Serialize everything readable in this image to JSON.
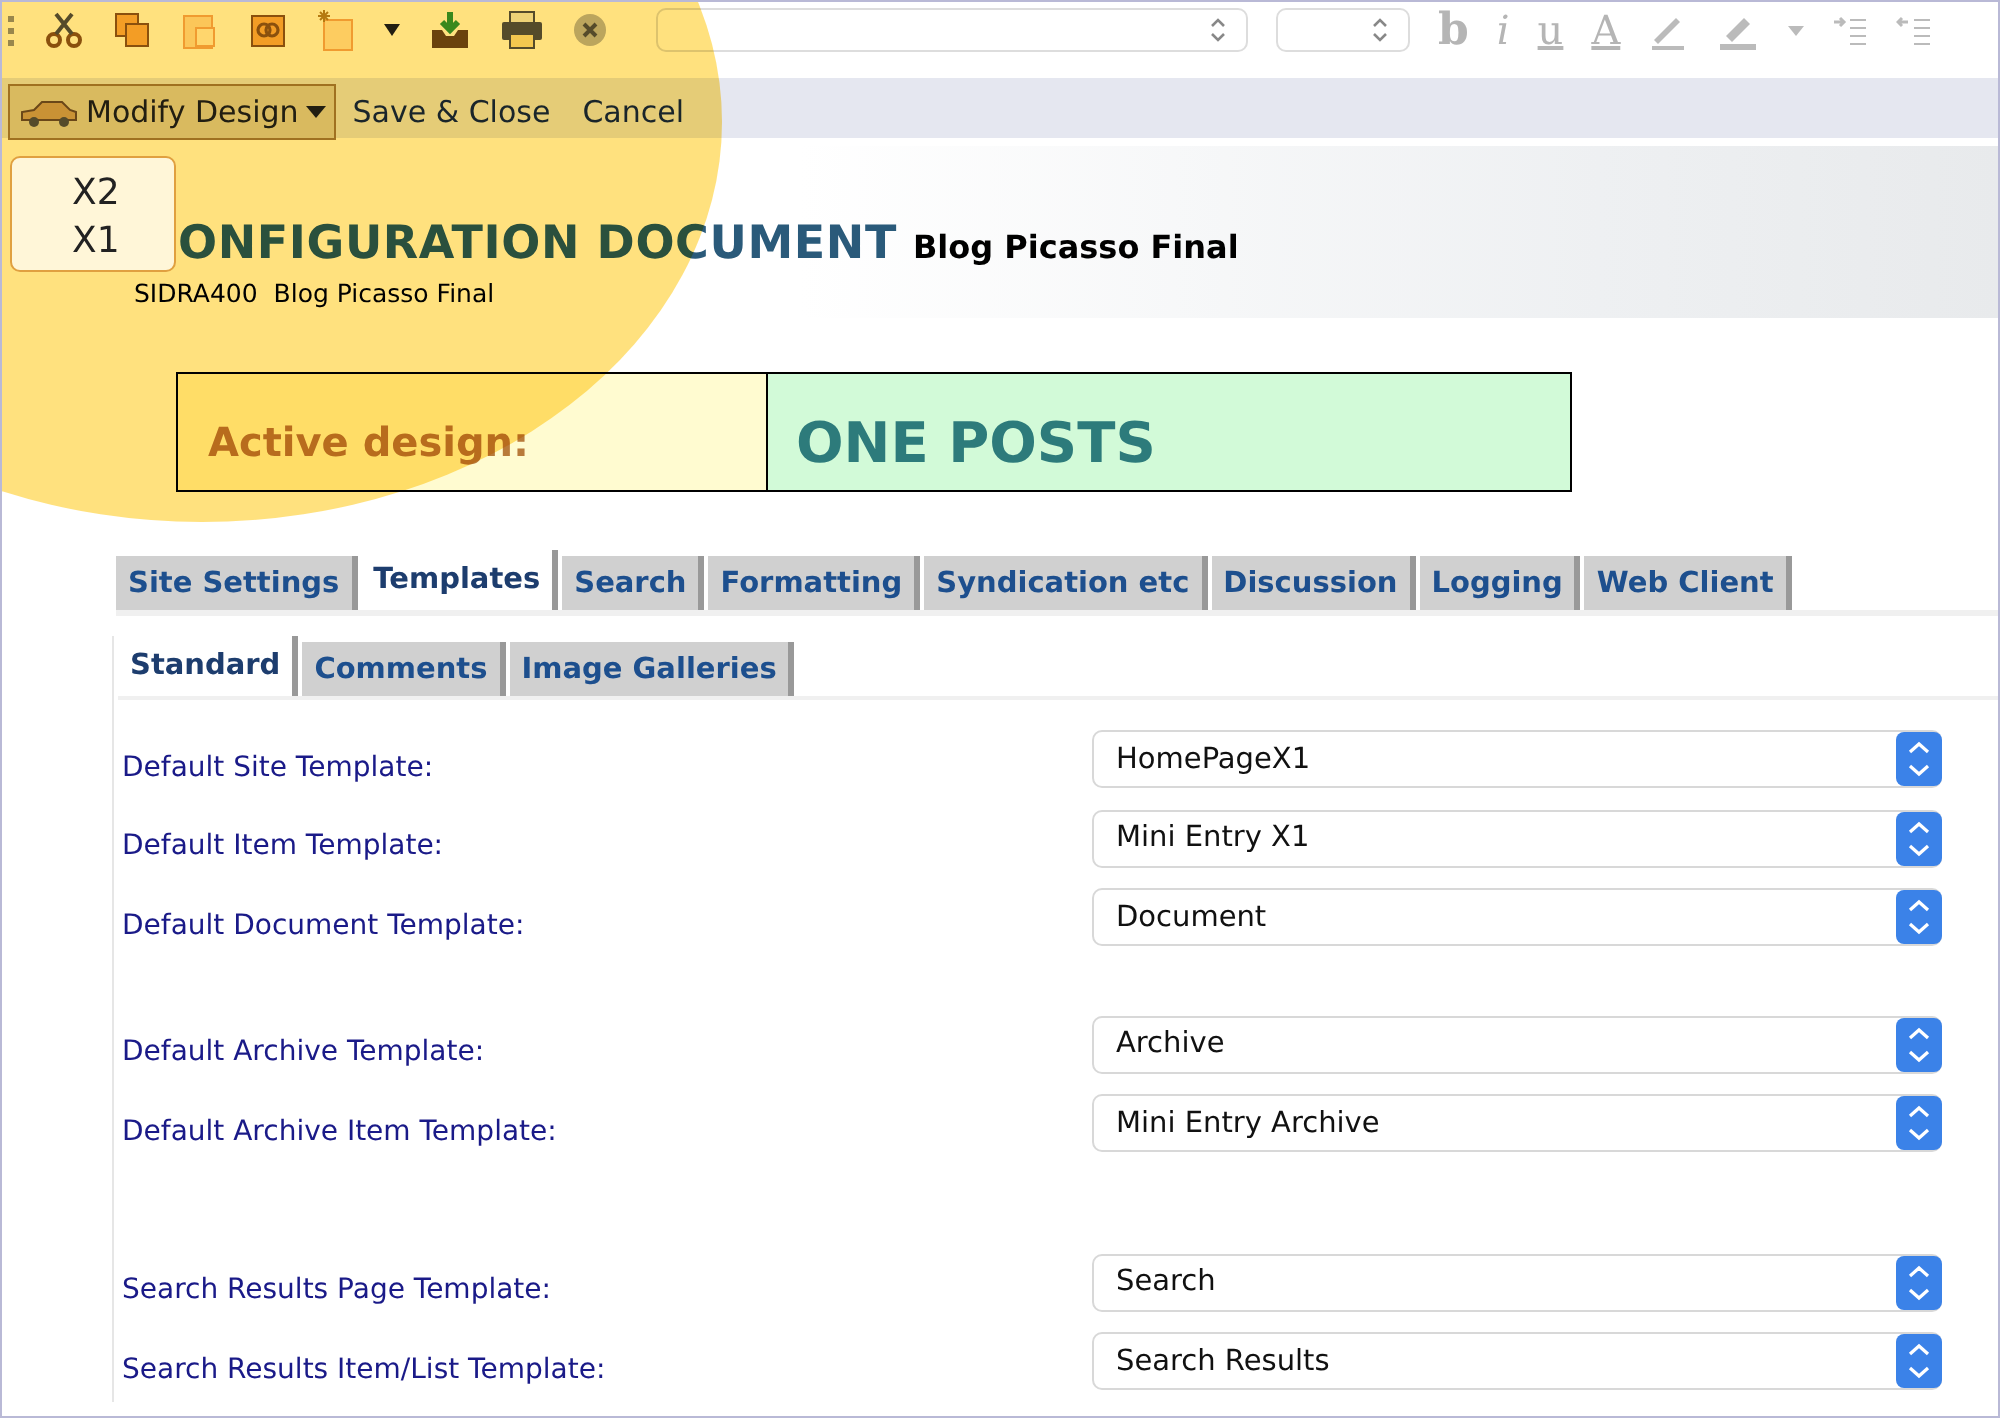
{
  "toolbar": {
    "format_buttons": [
      {
        "label": "b",
        "kind": "bold"
      },
      {
        "label": "i",
        "kind": "italic"
      },
      {
        "label": "u",
        "kind": "underline"
      },
      {
        "label": "A",
        "kind": "color"
      }
    ]
  },
  "actions": {
    "menu_button": {
      "label": "Modify Design",
      "expanded": true,
      "items": [
        "X2",
        "X1"
      ]
    },
    "buttons": [
      "Save & Close",
      "Cancel"
    ]
  },
  "header": {
    "title": "ONFIGURATION DOCUMENT",
    "title_suffix": "Blog Picasso Final",
    "subtitle": "SIDRA400  Blog Picasso Final"
  },
  "active_design": {
    "label": "Active design:",
    "value": "ONE POSTS"
  },
  "tabs": [
    {
      "label": "Site Settings",
      "selected": false
    },
    {
      "label": "Templates",
      "selected": true
    },
    {
      "label": "Search",
      "selected": false
    },
    {
      "label": "Formatting",
      "selected": false
    },
    {
      "label": "Syndication etc",
      "selected": false
    },
    {
      "label": "Discussion",
      "selected": false
    },
    {
      "label": "Logging",
      "selected": false
    },
    {
      "label": "Web Client",
      "selected": false
    }
  ],
  "subtabs": [
    {
      "label": "Standard",
      "selected": true
    },
    {
      "label": "Comments",
      "selected": false
    },
    {
      "label": "Image Galleries",
      "selected": false
    }
  ],
  "form_groups": [
    [
      {
        "label": "Default Site Template:",
        "value": "HomePageX1"
      },
      {
        "label": "Default Item Template:",
        "value": "Mini Entry X1"
      },
      {
        "label": "Default Document Template:",
        "value": "Document"
      }
    ],
    [
      {
        "label": "Default Archive Template:",
        "value": "Archive"
      },
      {
        "label": "Default Archive Item Template:",
        "value": "Mini Entry Archive"
      }
    ],
    [
      {
        "label": "Search Results Page Template:",
        "value": "Search"
      },
      {
        "label": "Search Results Item/List Template:",
        "value": "Search Results"
      }
    ]
  ]
}
